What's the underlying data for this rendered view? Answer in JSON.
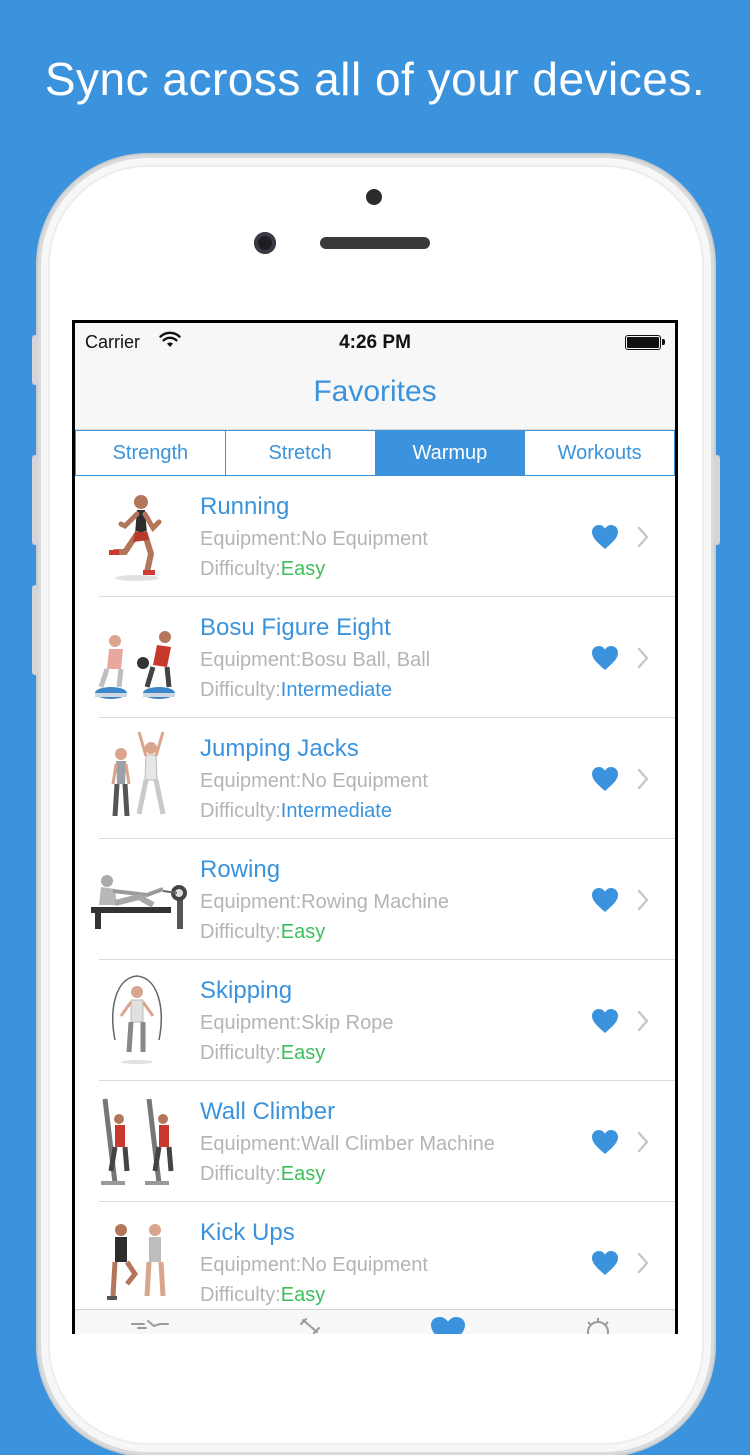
{
  "headline": "Sync across all of your devices.",
  "status_bar": {
    "carrier": "Carrier",
    "time": "4:26 PM",
    "wifi_icon": "wifi-icon",
    "battery_icon": "battery-icon"
  },
  "navbar": {
    "title": "Favorites"
  },
  "segments": [
    {
      "label": "Strength",
      "active": false
    },
    {
      "label": "Stretch",
      "active": false
    },
    {
      "label": "Warmup",
      "active": true
    },
    {
      "label": "Workouts",
      "active": false
    }
  ],
  "labels": {
    "equipment": "Equipment:",
    "difficulty": "Difficulty:"
  },
  "exercises": [
    {
      "name": "Running",
      "equipment": "No Equipment",
      "difficulty": "Easy"
    },
    {
      "name": "Bosu Figure Eight",
      "equipment": "Bosu Ball, Ball",
      "difficulty": "Intermediate"
    },
    {
      "name": "Jumping Jacks",
      "equipment": "No Equipment",
      "difficulty": "Intermediate"
    },
    {
      "name": "Rowing",
      "equipment": "Rowing Machine",
      "difficulty": "Easy"
    },
    {
      "name": "Skipping",
      "equipment": "Skip Rope",
      "difficulty": "Easy"
    },
    {
      "name": "Wall Climber",
      "equipment": "Wall Climber Machine",
      "difficulty": "Easy"
    },
    {
      "name": "Kick Ups",
      "equipment": "No Equipment",
      "difficulty": "Easy"
    }
  ],
  "colors": {
    "background": "#3a93dc",
    "accent": "#3a93dc",
    "easy": "#3cbf5c",
    "intermediate": "#3a93dc",
    "muted_text": "#b4b4b8"
  },
  "tab_bar_icons": [
    "exercises-icon",
    "dumbbell-icon",
    "heart-icon",
    "gear-icon"
  ]
}
